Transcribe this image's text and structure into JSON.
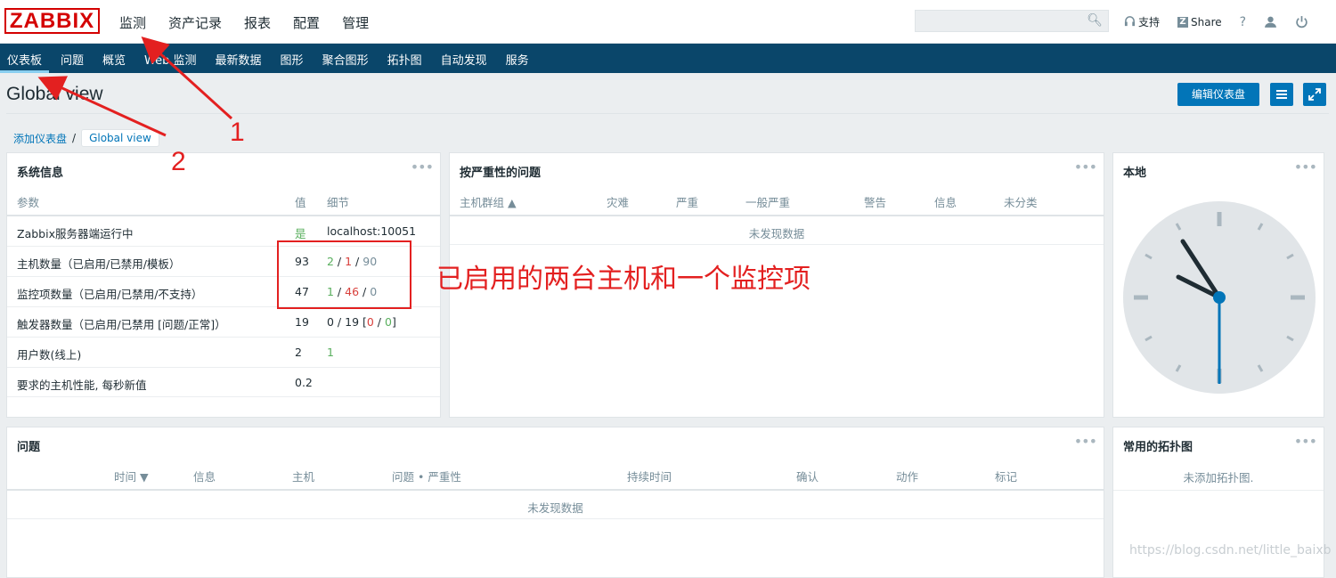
{
  "topbar": {
    "logo": "ZABBIX",
    "menu": [
      "监测",
      "资产记录",
      "报表",
      "配置",
      "管理"
    ],
    "support": "支持",
    "share": "Share",
    "help": "?"
  },
  "submenu": [
    "仪表板",
    "问题",
    "概览",
    "Web 监测",
    "最新数据",
    "图形",
    "聚合图形",
    "拓扑图",
    "自动发现",
    "服务"
  ],
  "page": {
    "title": "Global view",
    "edit_button": "编辑仪表盘",
    "breadcrumb": {
      "parent": "添加仪表盘",
      "sep": "/",
      "current": "Global view"
    }
  },
  "sysinfo": {
    "title": "系统信息",
    "headers": {
      "param": "参数",
      "value": "值",
      "detail": "细节"
    },
    "rows": [
      {
        "param": "Zabbix服务器端运行中",
        "value": "是",
        "detail": "localhost:10051"
      },
      {
        "param": "主机数量（已启用/已禁用/模板）",
        "value": "93",
        "d1": "2",
        "d2": "1",
        "d3": "90"
      },
      {
        "param": "监控项数量（已启用/已禁用/不支持）",
        "value": "47",
        "d1": "1",
        "d2": "46",
        "d3": "0"
      },
      {
        "param": "触发器数量（已启用/已禁用 [问题/正常]）",
        "value": "19",
        "d1": "0 / 19 [",
        "d2": "0",
        "d3": "0"
      },
      {
        "param": "用户数(线上)",
        "value": "2",
        "detail": "1"
      },
      {
        "param": "要求的主机性能, 每秒新值",
        "value": "0.2",
        "detail": ""
      }
    ]
  },
  "severity": {
    "title": "按严重性的问题",
    "headers": [
      "主机群组 ▲",
      "灾难",
      "严重",
      "一般严重",
      "警告",
      "信息",
      "未分类"
    ],
    "empty": "未发现数据"
  },
  "clock": {
    "title": "本地"
  },
  "problems": {
    "title": "问题",
    "headers": [
      "时间 ▼",
      "信息",
      "主机",
      "问题 • 严重性",
      "持续时间",
      "确认",
      "动作",
      "标记"
    ],
    "empty": "未发现数据"
  },
  "maps": {
    "title": "常用的拓扑图",
    "empty": "未添加拓扑图."
  },
  "annotations": {
    "text": "已启用的两台主机和一个监控项",
    "num1": "1",
    "num2": "2"
  },
  "watermark": "https://blog.csdn.net/little_baixb",
  "colors": {
    "brand": "#d40000",
    "nav": "#0a466a",
    "button": "#0275b8",
    "annotation": "#e32020"
  }
}
